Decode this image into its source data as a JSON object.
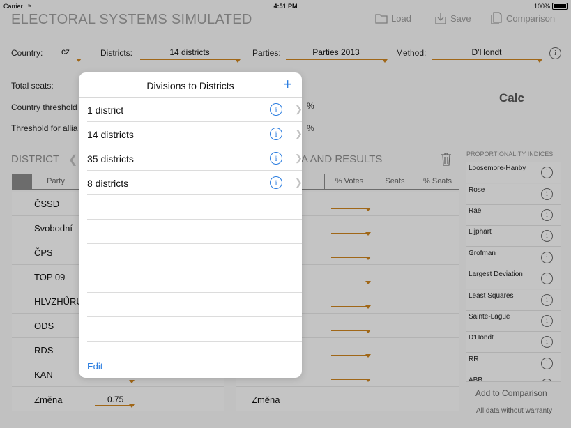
{
  "status": {
    "carrier": "Carrier",
    "time": "4:51 PM",
    "battery": "100%"
  },
  "header": {
    "title": "ELECTORAL SYSTEMS SIMULATED",
    "load": "Load",
    "save": "Save",
    "comparison": "Comparison"
  },
  "settings": {
    "country_label": "Country:",
    "country_value": "cz",
    "districts_label": "Districts:",
    "districts_value": "14 districts",
    "parties_label": "Parties:",
    "parties_value": "Parties 2013",
    "method_label": "Method:",
    "method_value": "D'Hondt",
    "total_seats_label": "Total seats:",
    "country_threshold_label": "Country threshold",
    "alliance_threshold_label": "Threshold for allia",
    "percent": "%",
    "calc": "Calc"
  },
  "district": {
    "header": "DISTRICT",
    "results_header": "A AND RESULTS",
    "columns": [
      "Party",
      "% Votes",
      "Seats",
      "% Seats"
    ],
    "parties": [
      "ČSSD",
      "Svobodní",
      "ČPS",
      "TOP 09",
      "HLVZHŮRU",
      "ODS",
      "RDS",
      "KAN",
      "Změna"
    ],
    "last_value": "0.75",
    "right_last_party": "Změna"
  },
  "proportionality": {
    "header": "PROPORTIONALITY INDICES",
    "items": [
      "Loosemore-Hanby",
      "Rose",
      "Rae",
      "Lijphart",
      "Grofman",
      "Largest Deviation",
      "Least Squares",
      "Sainte-Laguë",
      "D'Hondt",
      "RR",
      "ABB"
    ],
    "add_to_comparison": "Add to Comparison",
    "warranty": "All data without warranty"
  },
  "popover": {
    "title": "Divisions to Districts",
    "items": [
      "1 district",
      "14 districts",
      "35 districts",
      "8 districts"
    ],
    "edit": "Edit"
  }
}
